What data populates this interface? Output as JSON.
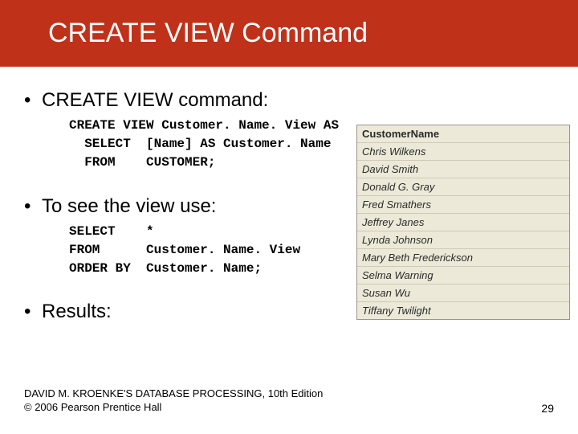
{
  "title": "CREATE VIEW Command",
  "bullet1": "CREATE VIEW command:",
  "code1": "CREATE VIEW Customer. Name. View AS\n  SELECT  [Name] AS Customer. Name\n  FROM    CUSTOMER;",
  "bullet2": "To see the view use:",
  "code2": "SELECT    *\nFROM      Customer. Name. View\nORDER BY  Customer. Name;",
  "bullet3": "Results:",
  "table": {
    "header": "CustomerName",
    "rows": [
      "Chris Wilkens",
      "David Smith",
      "Donald G. Gray",
      "Fred Smathers",
      "Jeffrey Janes",
      "Lynda Johnson",
      "Mary Beth Frederickson",
      "Selma Warning",
      "Susan Wu",
      "Tiffany Twilight"
    ]
  },
  "footer": {
    "line1": "DAVID M. KROENKE'S DATABASE PROCESSING, 10th Edition",
    "line2": "© 2006 Pearson Prentice Hall",
    "page": "29"
  }
}
